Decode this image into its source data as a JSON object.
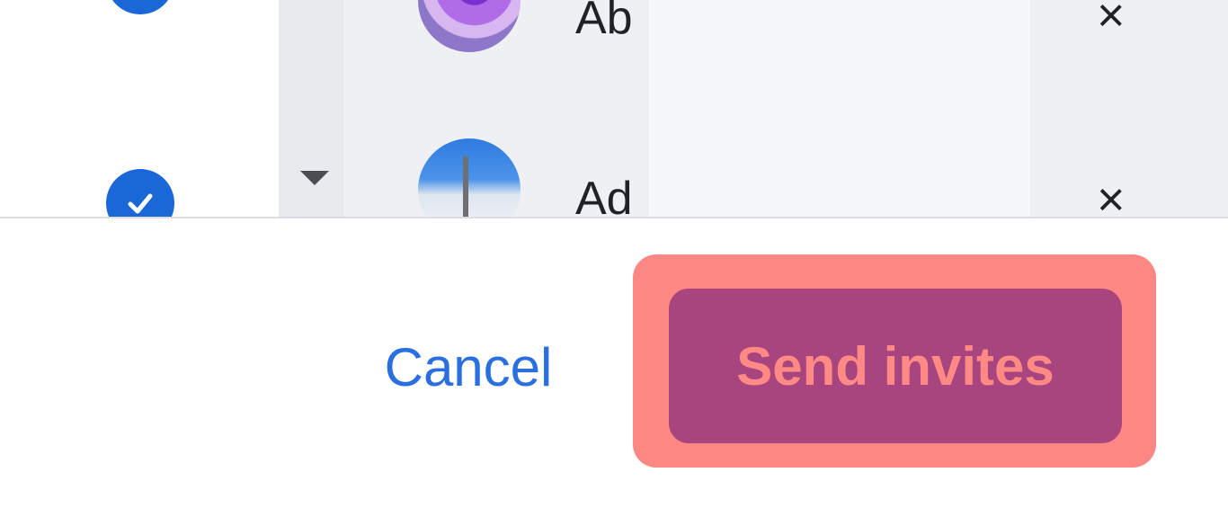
{
  "invite_list": {
    "rows": [
      {
        "name": "Ab",
        "selected": true,
        "remove_icon": "close-icon"
      },
      {
        "name": "Ad",
        "selected": true,
        "remove_icon": "close-icon"
      }
    ],
    "remove_glyph": "×"
  },
  "footer": {
    "cancel_label": "Cancel",
    "send_label": "Send invites"
  },
  "colors": {
    "accent": "#1a67d8",
    "link": "#2a6fe0",
    "send_button": "#a8457f",
    "highlight": "#fd8782"
  }
}
